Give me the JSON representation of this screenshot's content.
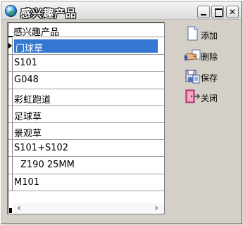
{
  "window": {
    "title": "感兴趣产品",
    "controls": [
      "minimize",
      "maximize",
      "close"
    ]
  },
  "grid": {
    "header": "感兴趣产品",
    "rows": [
      {
        "label": "门球草",
        "selected": true
      },
      {
        "label": "S101"
      },
      {
        "label": "G048"
      },
      {
        "label": "彩虹跑道"
      },
      {
        "label": "足球草"
      },
      {
        "label": "景观草"
      },
      {
        "label": "S101+S102"
      },
      {
        "label": "Z190 25MM"
      },
      {
        "label": "M101"
      }
    ],
    "scroll_left": "‹",
    "scroll_right": "›"
  },
  "actions": [
    {
      "key": "add",
      "label": "添加",
      "icon": "document-icon"
    },
    {
      "key": "delete",
      "label": "删除",
      "icon": "hand-delete-icon"
    },
    {
      "key": "save",
      "label": "保存",
      "icon": "save-icon"
    },
    {
      "key": "close",
      "label": "关闭",
      "icon": "exit-icon"
    }
  ],
  "colors": {
    "selection": "#3478d2",
    "window_bg": "#d4d0c8",
    "grid_bg": "#ffffff"
  }
}
